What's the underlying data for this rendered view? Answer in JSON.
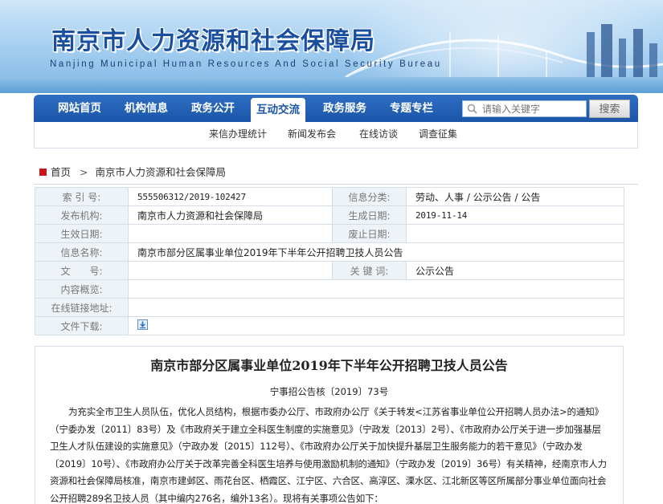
{
  "header": {
    "title": "南京市人力资源和社会保障局",
    "subtitle": "Nanjing Municipal Human Resources And Social Security Bureau"
  },
  "nav": {
    "items": [
      {
        "label": "网站首页"
      },
      {
        "label": "机构信息"
      },
      {
        "label": "政务公开"
      },
      {
        "label": "互动交流",
        "active": true
      },
      {
        "label": "政务服务"
      },
      {
        "label": "专题专栏"
      }
    ],
    "search_placeholder": "请输入关键字",
    "search_button": "搜索"
  },
  "subnav": {
    "items": [
      {
        "label": "来信办理统计"
      },
      {
        "label": "新闻发布会"
      },
      {
        "label": "在线访谈"
      },
      {
        "label": "调查征集"
      }
    ]
  },
  "breadcrumb": {
    "home": "首页",
    "separator": ">",
    "current": "南京市人力资源和社会保障局"
  },
  "meta": {
    "index_label": "索 引 号:",
    "index_value": "555506312/2019-102427",
    "category_label": "信息分类:",
    "category_value": "劳动、人事 / 公示公告 / 公告",
    "publisher_label": "发布机构:",
    "publisher_value": "南京市人力资源和社会保障局",
    "created_label": "生成日期:",
    "created_value": "2019-11-14",
    "effective_label": "生效日期:",
    "effective_value": "",
    "repeal_label": "废止日期:",
    "repeal_value": "",
    "name_label": "信息名称:",
    "name_value": "南京市部分区属事业单位2019年下半年公开招聘卫技人员公告",
    "docno_label": "文　　号:",
    "docno_value": "",
    "keywords_label": "关 键 词:",
    "keywords_value": "公示公告",
    "summary_label": "内容概览:",
    "summary_value": "",
    "link_label": "在线链接地址:",
    "link_value": "",
    "download_label": "文件下载:"
  },
  "article": {
    "title": "南京市部分区属事业单位2019年下半年公开招聘卫技人员公告",
    "doc_number": "宁事招公告核〔2019〕73号",
    "body": "为充实全市卫生人员队伍，优化人员结构，根据市委办公厅、市政府办公厅《关于转发<江苏省事业单位公开招聘人员办法>的通知》（宁委办发〔2011〕83号）及《市政府关于建立全科医生制度的实施意见》（宁政发〔2013〕2号）、《市政府办公厅关于进一步加强基层卫生人才队伍建设的实施意见》（宁政办发〔2015〕112号）、《市政府办公厅关于加快提升基层卫生服务能力的若干意见》（宁政办发〔2019〕10号）、《市政府办公厅关于改革完善全科医生培养与使用激励机制的通知》（宁政办发〔2019〕36号）有关精神，经南京市人力资源和社会保障局核准，南京市建邺区、雨花台区、栖霞区、江宁区、六合区、高淳区、溧水区、江北新区等区所属部分事业单位面向社会公开招聘289名卫技人员（其中编内276名，编外13名）。现将有关事项公告如下："
  },
  "colors": {
    "nav_blue": "#1a55a8",
    "label_bg": "#eef3f8",
    "home_icon": "#c8161d"
  }
}
